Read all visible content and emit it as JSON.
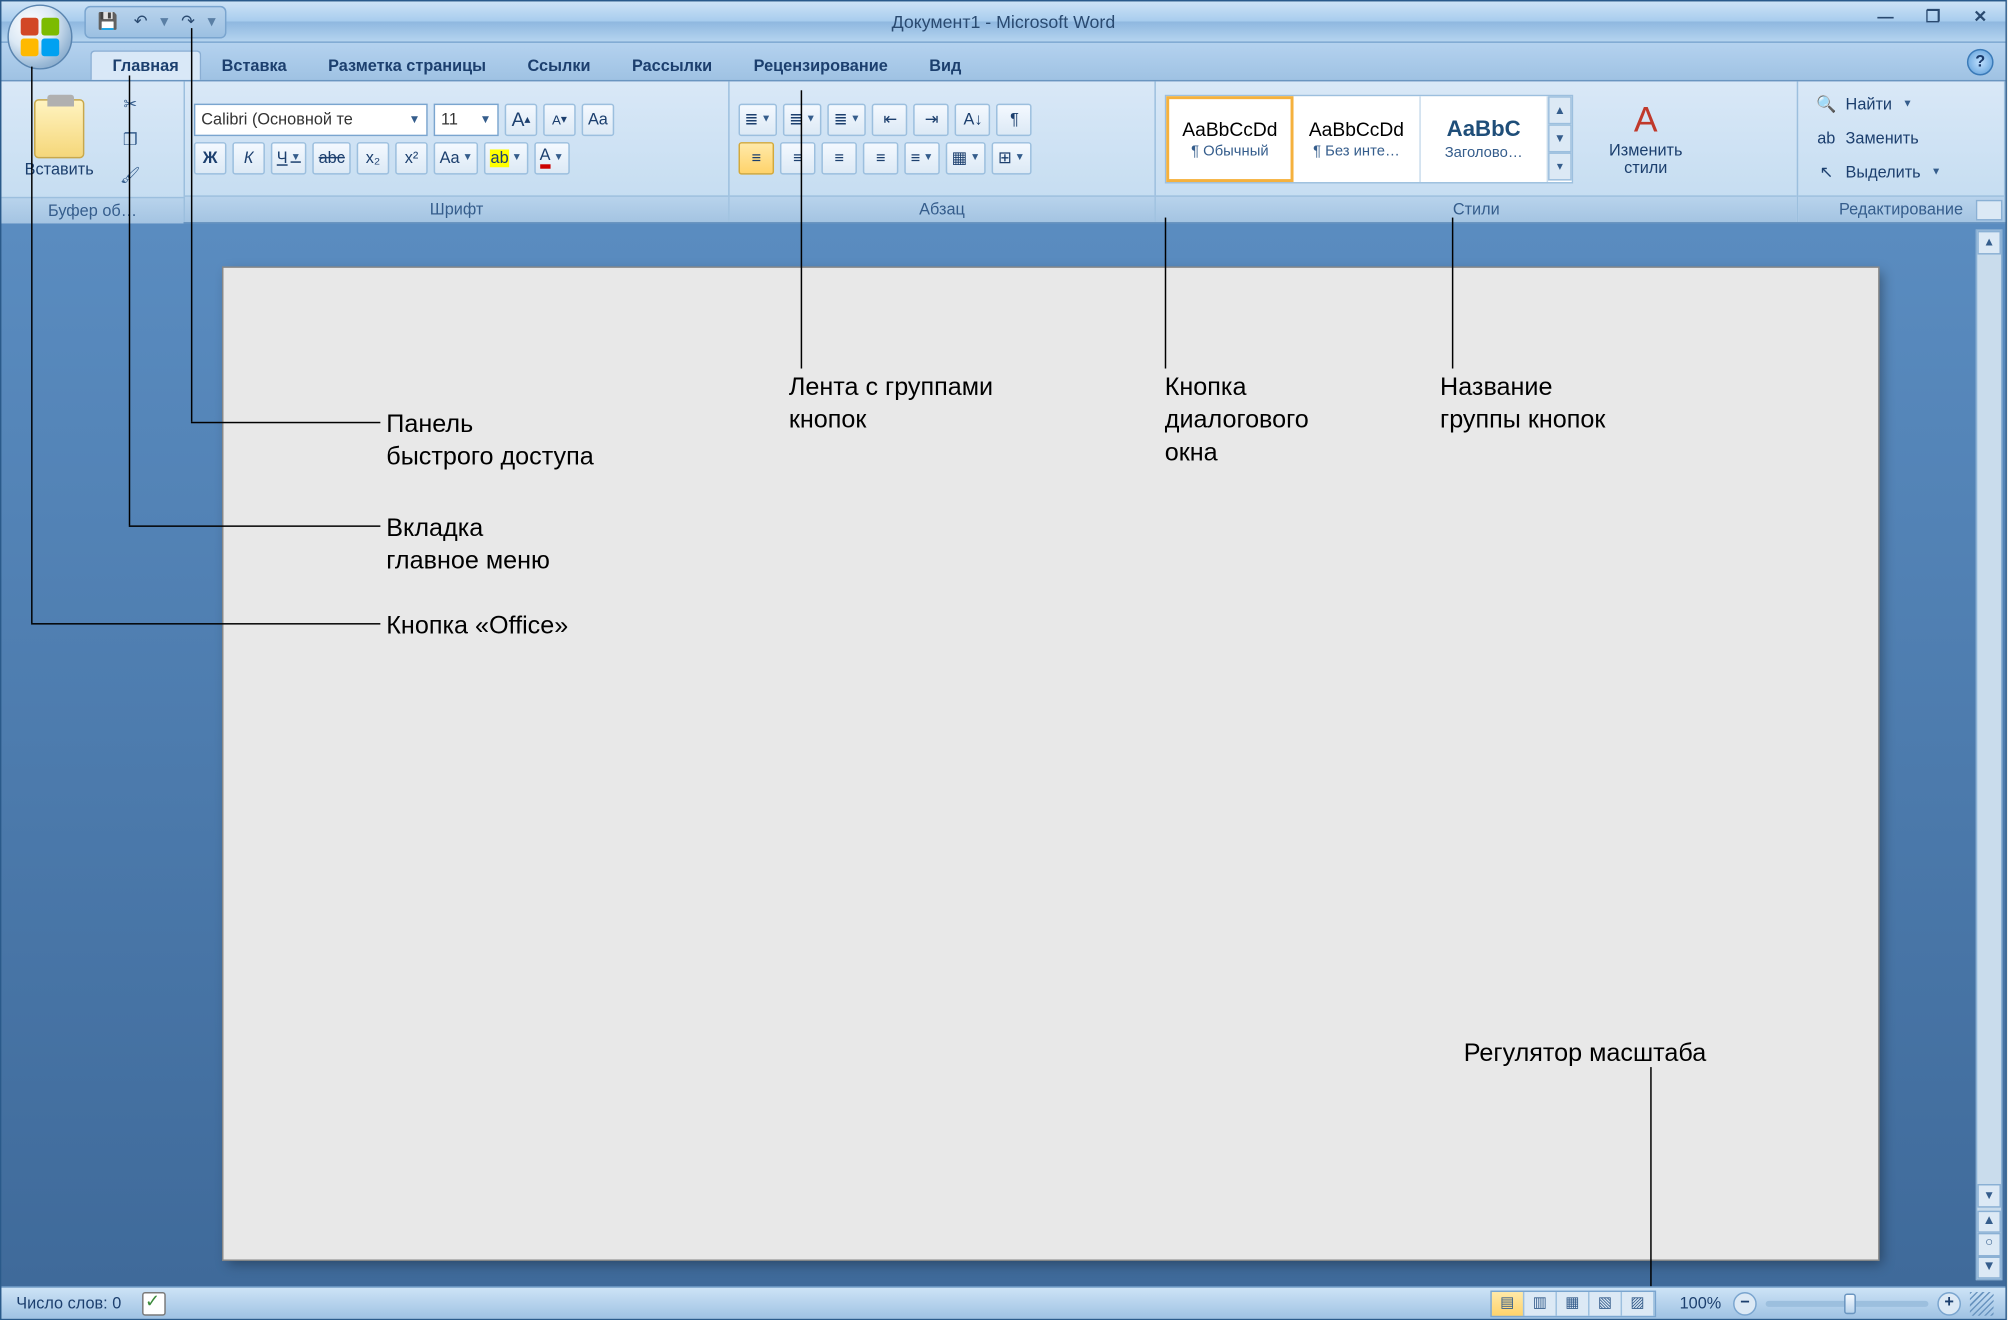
{
  "title": "Документ1 - Microsoft Word",
  "qat": {
    "save": "💾",
    "undo": "↶",
    "redo": "↷",
    "drop": "▾",
    "more": "▾"
  },
  "win": {
    "min": "—",
    "restore": "❐",
    "close": "✕"
  },
  "tabs": [
    "Главная",
    "Вставка",
    "Разметка страницы",
    "Ссылки",
    "Рассылки",
    "Рецензирование",
    "Вид"
  ],
  "help": "?",
  "ribbon": {
    "clipboard": {
      "paste": "Вставить",
      "label": "Буфер об…"
    },
    "font": {
      "name": "Calibri (Основной те",
      "size": "11",
      "grow": "A",
      "shrink": "A",
      "clear": "Aa",
      "bold": "Ж",
      "italic": "К",
      "underline": "Ч",
      "strike": "abc",
      "sub": "x₂",
      "sup": "x²",
      "case": "Aa",
      "highlight": "ab",
      "color": "A",
      "label": "Шрифт"
    },
    "para": {
      "bul": "≣",
      "num": "≣",
      "ml": "≣",
      "decInd": "⇤",
      "incInd": "⇥",
      "sort": "A↓",
      "marks": "¶",
      "al": "≡",
      "ac": "≡",
      "ar": "≡",
      "aj": "≡",
      "ls": "≡",
      "shade": "▦",
      "border": "⊞",
      "label": "Абзац"
    },
    "styles": {
      "preview": "AaBbCcDd",
      "previewBlue": "AaBbC",
      "s1": "¶ Обычный",
      "s2": "¶ Без инте…",
      "s3": "Заголово…",
      "change": "Изменить стили",
      "label": "Стили"
    },
    "edit": {
      "find": "Найти",
      "replace": "Заменить",
      "select": "Выделить",
      "label": "Редактирование"
    }
  },
  "status": {
    "words": "Число слов: 0",
    "zoom": "100%"
  },
  "callouts": {
    "qat": "Панель\nбыстрого доступа",
    "tab": "Вкладка\nглавное меню",
    "office": "Кнопка «Office»",
    "ribbon": "Лента с группами\nкнопок",
    "launcher": "Кнопка\nдиалогового\nокна",
    "groupname": "Название\nгруппы кнопок",
    "zoom": "Регулятор масштаба"
  }
}
